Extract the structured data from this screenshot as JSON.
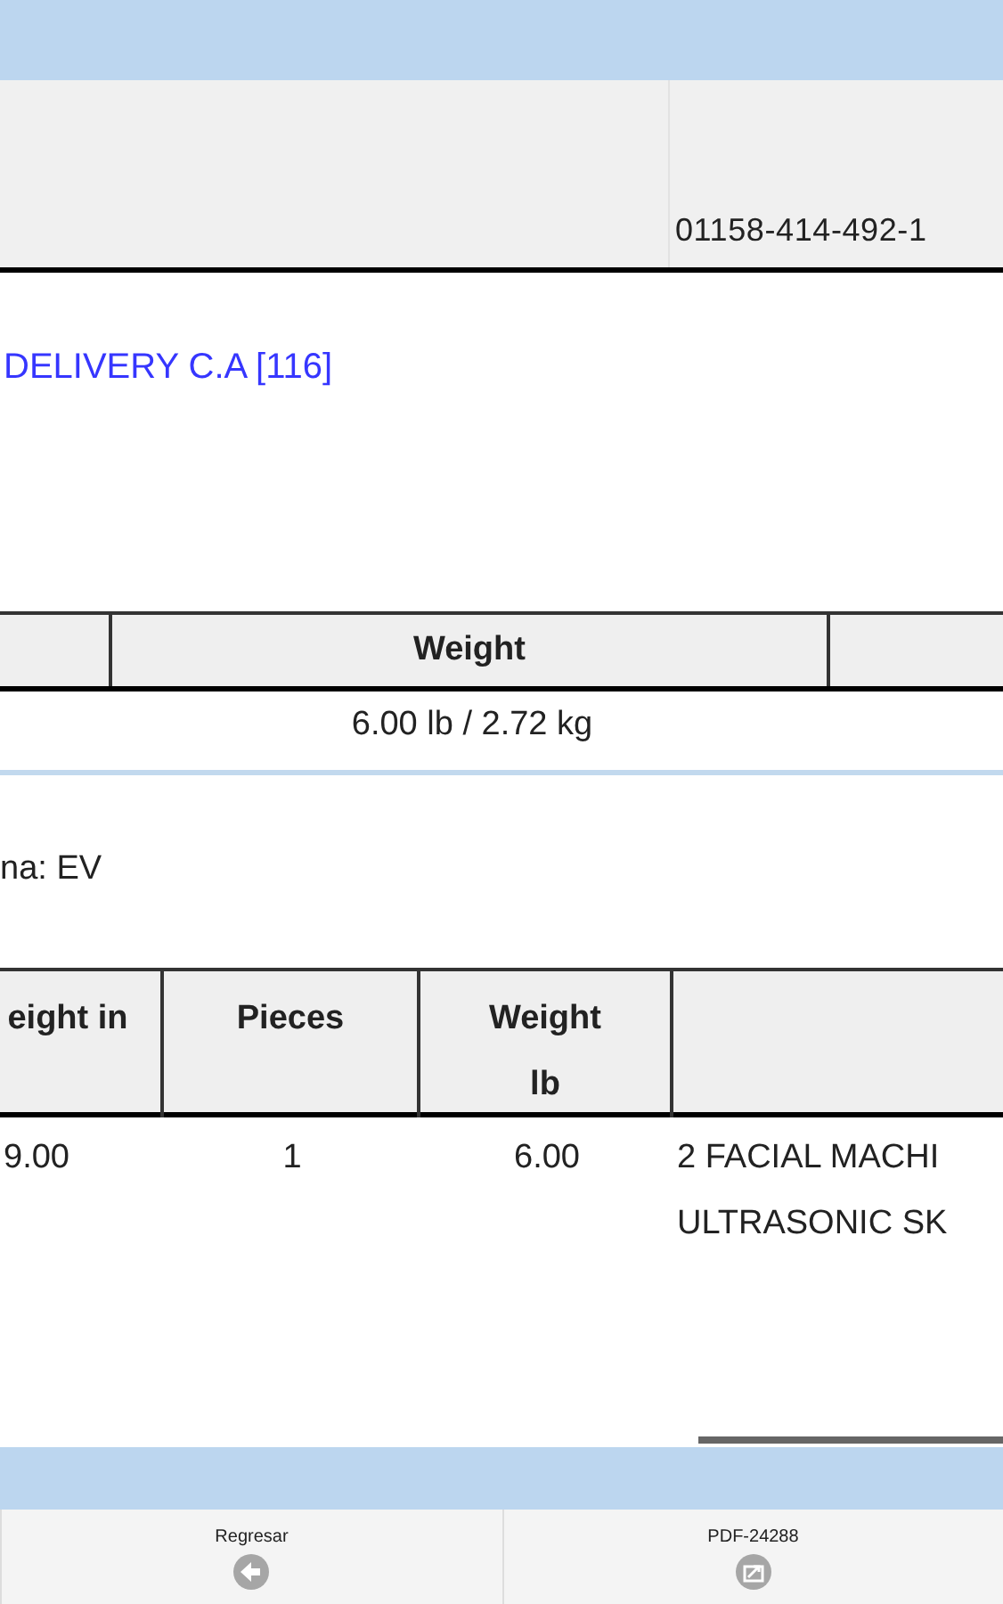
{
  "header": {
    "column_2": "01158-414-492-1"
  },
  "consignee": {
    "link": "DELIVERY C.A [116]"
  },
  "summary_table": {
    "columns": [
      "Weight"
    ],
    "rows": [
      [
        "6.00 lb / 2.72 kg"
      ]
    ]
  },
  "note": "na: EV",
  "items_table": {
    "columns": [
      "eight in",
      "Pieces",
      "Weight lb"
    ],
    "rows": [
      {
        "cells": [
          "9.00",
          "1",
          "6.00"
        ],
        "description": [
          "2 FACIAL MACHI",
          "ULTRASONIC SK"
        ]
      }
    ]
  },
  "footer_buttons": [
    {
      "label": "Regresar",
      "kind": "back"
    },
    {
      "label": "PDF-24288",
      "kind": "pdf"
    }
  ]
}
